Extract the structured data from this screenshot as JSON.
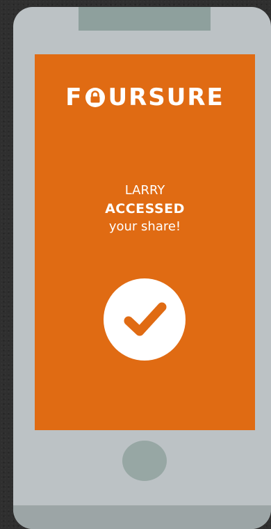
{
  "brand": {
    "part1": "F",
    "part2": "URSURE",
    "lock_icon": "padlock-icon"
  },
  "message": {
    "name": "LARRY",
    "action": "ACCESSED",
    "rest": "your share!"
  },
  "icons": {
    "status": "checkmark-icon"
  },
  "colors": {
    "screen_background": "#e06b13",
    "phone_body": "#bcc2c5",
    "accent": "#ffffff"
  }
}
